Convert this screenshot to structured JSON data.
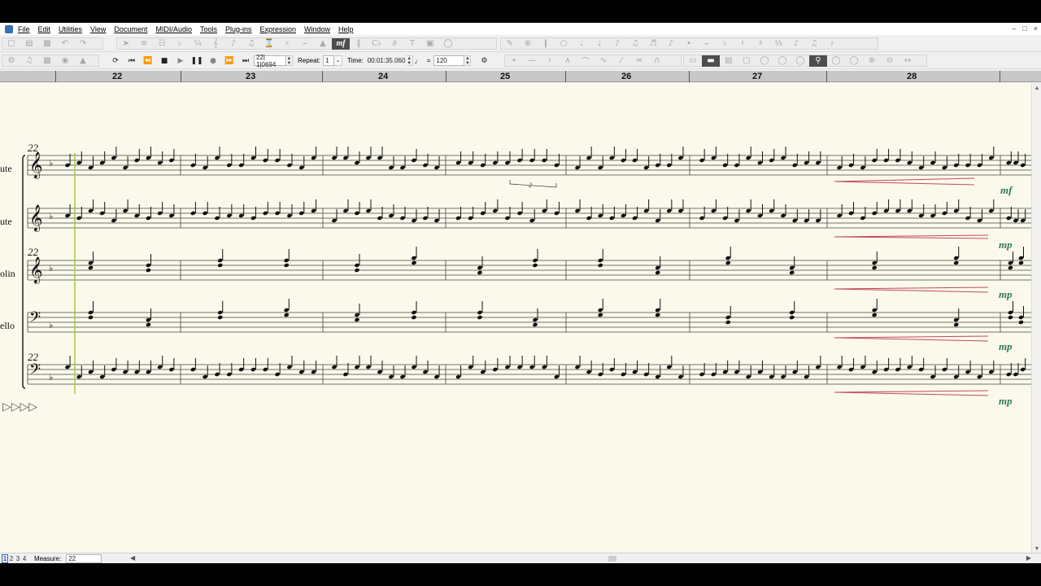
{
  "menu": {
    "items": [
      "File",
      "Edit",
      "Utilities",
      "View",
      "Document",
      "MIDI/Audio",
      "Tools",
      "Plug-ins",
      "Expression",
      "Window",
      "Help"
    ]
  },
  "playback": {
    "counter": "22| 1|0694",
    "repeat_label": "Repeat:",
    "repeat_value": "1",
    "time_label": "Time:",
    "time_value": "00:01:35.060",
    "tempo_value": "120"
  },
  "ruler": {
    "measures": [
      "22",
      "23",
      "24",
      "25",
      "26",
      "27",
      "28"
    ]
  },
  "score": {
    "staff_labels": [
      "ute",
      "ute",
      "olin",
      "ello"
    ],
    "system_measure_numbers": [
      "22",
      "22",
      "22"
    ],
    "dynamics": [
      "mf",
      "mp",
      "mp",
      "mp",
      "mp"
    ],
    "triplet_label": "2"
  },
  "status": {
    "pages": [
      "1",
      "2",
      "3",
      "4"
    ],
    "measure_label": "Measure:",
    "measure_value": "22"
  },
  "colors": {
    "score_bg": "#fbf9ec",
    "dynamic": "#2f7d57",
    "hairpin": "#c04a5a",
    "barline_blue": "#4a7fc1",
    "playhead": "#a4c94a"
  }
}
